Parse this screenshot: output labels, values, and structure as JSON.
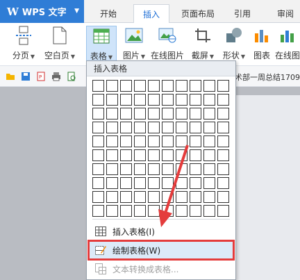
{
  "app": {
    "name": "WPS 文字"
  },
  "tabs": [
    {
      "label": "开始"
    },
    {
      "label": "插入"
    },
    {
      "label": "页面布局"
    },
    {
      "label": "引用"
    },
    {
      "label": "审阅"
    }
  ],
  "ribbon": {
    "page_break": "分页",
    "blank_page": "空白页",
    "table": "表格",
    "picture": "图片",
    "online_picture": "在线图片",
    "screenshot": "截屏",
    "shape": "形状",
    "chart": "图表",
    "online_more": "在线图"
  },
  "doc_title": "术部一周总结1709",
  "dropdown": {
    "header": "插入表格",
    "grid_rows": 10,
    "grid_cols": 10,
    "items": [
      {
        "label": "插入表格(I)",
        "icon": "table-icon",
        "state": "normal"
      },
      {
        "label": "绘制表格(W)",
        "icon": "draw-table-icon",
        "state": "highlighted"
      },
      {
        "label": "文本转换成表格...",
        "icon": "text-to-table-icon",
        "state": "disabled"
      }
    ]
  },
  "colors": {
    "app_button": "#2f7dd6",
    "active_tab_text": "#1e6fd6",
    "highlight_border": "#e43c3c",
    "annotation_arrow": "#e43c3c"
  }
}
